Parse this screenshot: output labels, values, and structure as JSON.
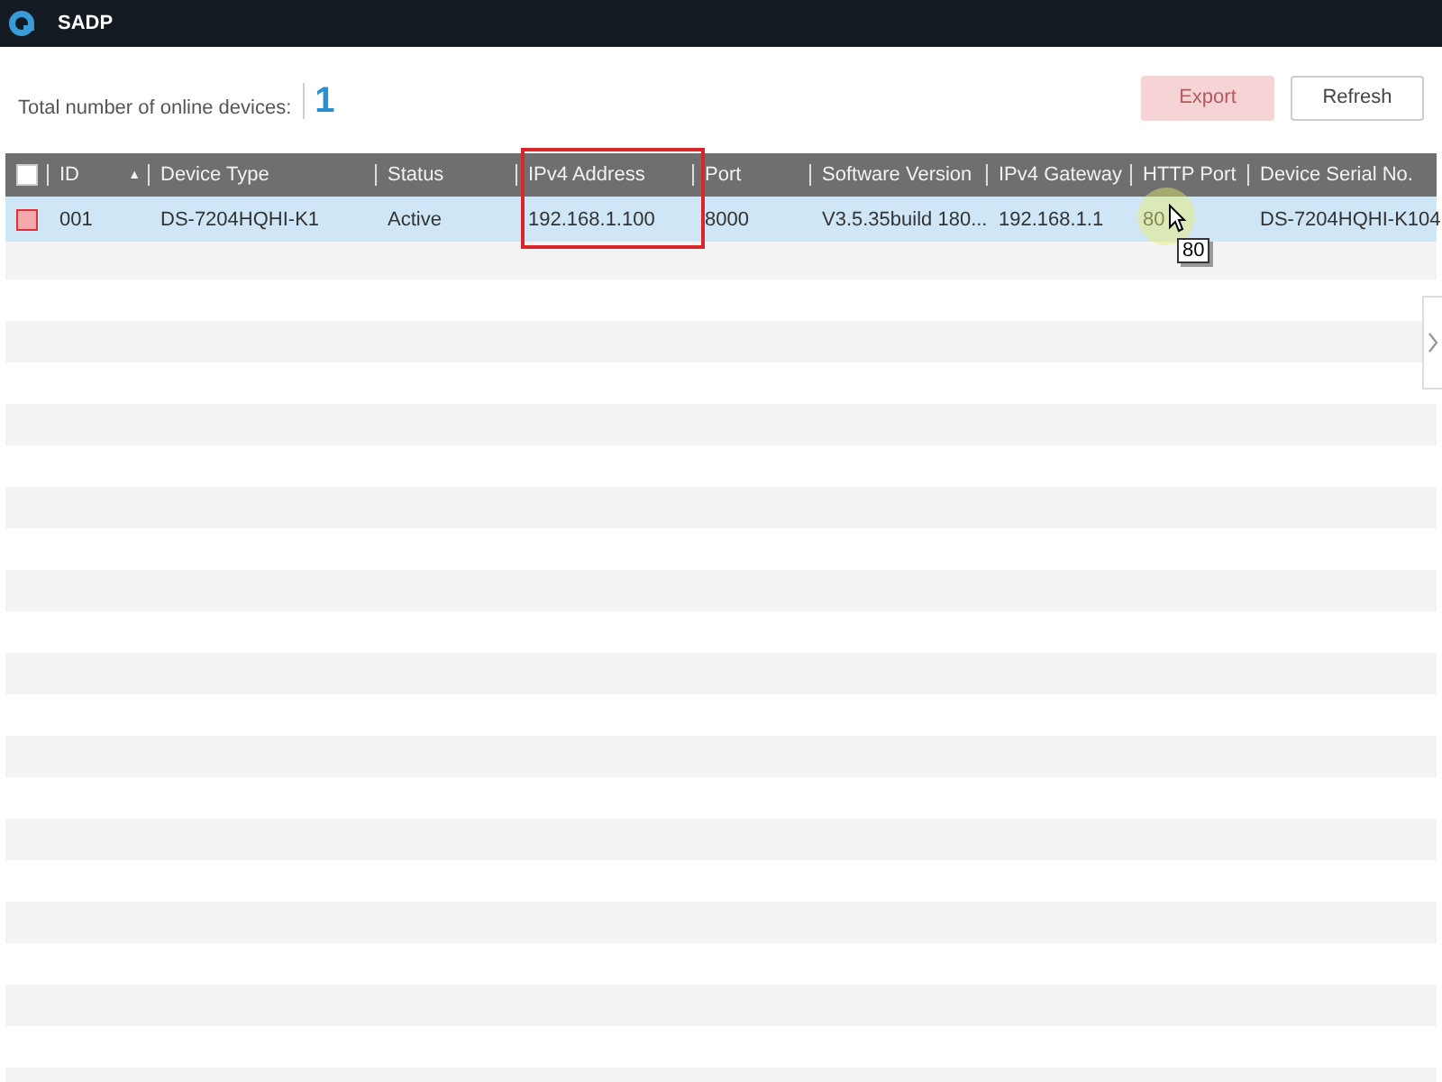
{
  "window": {
    "title": "SADP"
  },
  "summary": {
    "label": "Total number of online devices:",
    "count": "1"
  },
  "buttons": [
    {
      "label": "Export",
      "disabled": true
    },
    {
      "label": "Refresh",
      "disabled": false
    }
  ],
  "table": {
    "select_all": {
      "checked": false
    },
    "columns": [
      {
        "label": "ID",
        "sort_mark": "▲"
      },
      {
        "label": "Device Type"
      },
      {
        "label": "Status"
      },
      {
        "label": "IPv4 Address"
      },
      {
        "label": "Port"
      },
      {
        "label": "Software Version"
      },
      {
        "label": "IPv4 Gateway"
      },
      {
        "label": "HTTP Port"
      },
      {
        "label": "Device Serial No."
      }
    ],
    "rows": [
      {
        "selected": true,
        "checked": false,
        "cells": [
          "001",
          "DS-7204HQHI-K1",
          "Active",
          "192.168.1.100",
          "8000",
          "V3.5.35build 180...",
          "192.168.1.1",
          "80",
          "DS-7204HQHI-K104"
        ]
      }
    ]
  },
  "tooltip": {
    "text": "80"
  }
}
